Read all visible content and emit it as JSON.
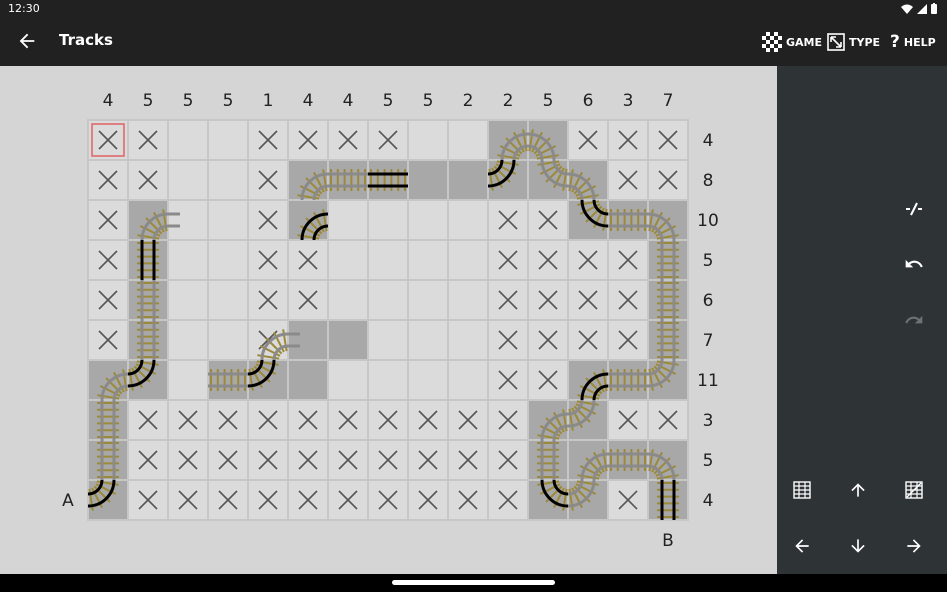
{
  "status": {
    "time": "12:30"
  },
  "appbar": {
    "title": "Tracks",
    "game_label": "GAME",
    "type_label": "TYPE",
    "help_label": "HELP"
  },
  "puzzle": {
    "col_clues": [
      "4",
      "5",
      "5",
      "5",
      "1",
      "4",
      "4",
      "5",
      "5",
      "2",
      "2",
      "5",
      "6",
      "3",
      "7"
    ],
    "row_clues": [
      "4",
      "8",
      "10",
      "5",
      "6",
      "7",
      "11",
      "3",
      "5",
      "4"
    ],
    "entry_label": "A",
    "exit_label": "B",
    "selected_cell": [
      0,
      0
    ],
    "filled_cells": [
      [
        0,
        10
      ],
      [
        0,
        11
      ],
      [
        1,
        5
      ],
      [
        1,
        6
      ],
      [
        1,
        7
      ],
      [
        1,
        8
      ],
      [
        1,
        9
      ],
      [
        1,
        10
      ],
      [
        1,
        11
      ],
      [
        1,
        12
      ],
      [
        2,
        1
      ],
      [
        2,
        5
      ],
      [
        2,
        12
      ],
      [
        2,
        13
      ],
      [
        2,
        14
      ],
      [
        3,
        1
      ],
      [
        3,
        14
      ],
      [
        4,
        1
      ],
      [
        4,
        14
      ],
      [
        5,
        1
      ],
      [
        5,
        5
      ],
      [
        5,
        6
      ],
      [
        5,
        14
      ],
      [
        6,
        0
      ],
      [
        6,
        1
      ],
      [
        6,
        3
      ],
      [
        6,
        4
      ],
      [
        6,
        5
      ],
      [
        6,
        12
      ],
      [
        6,
        13
      ],
      [
        6,
        14
      ],
      [
        7,
        0
      ],
      [
        7,
        11
      ],
      [
        7,
        12
      ],
      [
        8,
        0
      ],
      [
        8,
        11
      ],
      [
        8,
        12
      ],
      [
        8,
        13
      ],
      [
        8,
        14
      ],
      [
        9,
        0
      ],
      [
        9,
        11
      ],
      [
        9,
        12
      ],
      [
        9,
        14
      ]
    ],
    "crossed_cells": [
      [
        0,
        0
      ],
      [
        0,
        1
      ],
      [
        0,
        4
      ],
      [
        0,
        5
      ],
      [
        0,
        6
      ],
      [
        0,
        7
      ],
      [
        0,
        12
      ],
      [
        0,
        13
      ],
      [
        0,
        14
      ],
      [
        1,
        0
      ],
      [
        1,
        1
      ],
      [
        1,
        4
      ],
      [
        1,
        13
      ],
      [
        1,
        14
      ],
      [
        2,
        0
      ],
      [
        2,
        4
      ],
      [
        2,
        10
      ],
      [
        2,
        11
      ],
      [
        3,
        0
      ],
      [
        3,
        4
      ],
      [
        3,
        5
      ],
      [
        3,
        10
      ],
      [
        3,
        11
      ],
      [
        3,
        12
      ],
      [
        3,
        13
      ],
      [
        4,
        0
      ],
      [
        4,
        4
      ],
      [
        4,
        5
      ],
      [
        4,
        10
      ],
      [
        4,
        11
      ],
      [
        4,
        12
      ],
      [
        4,
        13
      ],
      [
        5,
        0
      ],
      [
        5,
        4
      ],
      [
        5,
        10
      ],
      [
        5,
        11
      ],
      [
        5,
        12
      ],
      [
        5,
        13
      ],
      [
        6,
        10
      ],
      [
        6,
        11
      ],
      [
        7,
        1
      ],
      [
        7,
        2
      ],
      [
        7,
        3
      ],
      [
        7,
        4
      ],
      [
        7,
        5
      ],
      [
        7,
        6
      ],
      [
        7,
        7
      ],
      [
        7,
        8
      ],
      [
        7,
        9
      ],
      [
        7,
        10
      ],
      [
        7,
        13
      ],
      [
        7,
        14
      ],
      [
        8,
        1
      ],
      [
        8,
        2
      ],
      [
        8,
        3
      ],
      [
        8,
        4
      ],
      [
        8,
        5
      ],
      [
        8,
        6
      ],
      [
        8,
        7
      ],
      [
        8,
        8
      ],
      [
        8,
        9
      ],
      [
        8,
        10
      ],
      [
        9,
        1
      ],
      [
        9,
        2
      ],
      [
        9,
        3
      ],
      [
        9,
        4
      ],
      [
        9,
        5
      ],
      [
        9,
        6
      ],
      [
        9,
        7
      ],
      [
        9,
        8
      ],
      [
        9,
        9
      ],
      [
        9,
        10
      ],
      [
        9,
        13
      ]
    ],
    "track_segments": [
      {
        "type": "curve",
        "cell": [
          9,
          0
        ],
        "from": "W",
        "to": "N",
        "fixed": true
      },
      {
        "type": "straight",
        "cell": [
          8,
          0
        ],
        "dir": "V"
      },
      {
        "type": "straight",
        "cell": [
          7,
          0
        ],
        "dir": "V"
      },
      {
        "type": "curve",
        "cell": [
          6,
          0
        ],
        "from": "S",
        "to": "E"
      },
      {
        "type": "curve",
        "cell": [
          6,
          1
        ],
        "from": "W",
        "to": "N",
        "fixed": true
      },
      {
        "type": "straight",
        "cell": [
          5,
          1
        ],
        "dir": "V"
      },
      {
        "type": "straight",
        "cell": [
          4,
          1
        ],
        "dir": "V"
      },
      {
        "type": "straight",
        "cell": [
          3,
          1
        ],
        "dir": "V",
        "fixed": true
      },
      {
        "type": "curve",
        "cell": [
          2,
          1
        ],
        "from": "S",
        "to": "E"
      },
      {
        "type": "stub",
        "cell": [
          2,
          2
        ],
        "dir": "W"
      },
      {
        "type": "straight",
        "cell": [
          6,
          3
        ],
        "dir": "H"
      },
      {
        "type": "curve",
        "cell": [
          6,
          4
        ],
        "from": "W",
        "to": "N",
        "fixed": true
      },
      {
        "type": "curve",
        "cell": [
          5,
          4
        ],
        "from": "S",
        "to": "E"
      },
      {
        "type": "stub",
        "cell": [
          5,
          5
        ],
        "dir": "W"
      },
      {
        "type": "curve",
        "cell": [
          2,
          5
        ],
        "from": "S",
        "to": "E",
        "fixed": true
      },
      {
        "type": "curve",
        "cell": [
          1,
          5
        ],
        "from": "S",
        "to": "E"
      },
      {
        "type": "straight",
        "cell": [
          1,
          6
        ],
        "dir": "H"
      },
      {
        "type": "straight",
        "cell": [
          1,
          7
        ],
        "dir": "H",
        "fixed": true
      },
      {
        "type": "curve",
        "cell": [
          1,
          10
        ],
        "from": "W",
        "to": "N",
        "fixed": true
      },
      {
        "type": "curve",
        "cell": [
          0,
          10
        ],
        "from": "S",
        "to": "E"
      },
      {
        "type": "curve",
        "cell": [
          0,
          11
        ],
        "from": "W",
        "to": "S"
      },
      {
        "type": "curve",
        "cell": [
          1,
          11
        ],
        "from": "N",
        "to": "E"
      },
      {
        "type": "curve",
        "cell": [
          1,
          12
        ],
        "from": "W",
        "to": "S"
      },
      {
        "type": "curve",
        "cell": [
          2,
          12
        ],
        "from": "N",
        "to": "E",
        "fixed": true
      },
      {
        "type": "straight",
        "cell": [
          2,
          13
        ],
        "dir": "H"
      },
      {
        "type": "curve",
        "cell": [
          2,
          14
        ],
        "from": "W",
        "to": "S"
      },
      {
        "type": "straight",
        "cell": [
          3,
          14
        ],
        "dir": "V"
      },
      {
        "type": "straight",
        "cell": [
          4,
          14
        ],
        "dir": "V"
      },
      {
        "type": "straight",
        "cell": [
          5,
          14
        ],
        "dir": "V"
      },
      {
        "type": "curve",
        "cell": [
          6,
          14
        ],
        "from": "N",
        "to": "W"
      },
      {
        "type": "straight",
        "cell": [
          6,
          13
        ],
        "dir": "H"
      },
      {
        "type": "curve",
        "cell": [
          6,
          12
        ],
        "from": "E",
        "to": "S",
        "fixed": true
      },
      {
        "type": "curve",
        "cell": [
          7,
          12
        ],
        "from": "N",
        "to": "W"
      },
      {
        "type": "curve",
        "cell": [
          7,
          11
        ],
        "from": "E",
        "to": "S"
      },
      {
        "type": "straight",
        "cell": [
          8,
          11
        ],
        "dir": "V"
      },
      {
        "type": "curve",
        "cell": [
          9,
          11
        ],
        "from": "N",
        "to": "E",
        "fixed": true
      },
      {
        "type": "curve",
        "cell": [
          9,
          12
        ],
        "from": "W",
        "to": "N"
      },
      {
        "type": "curve",
        "cell": [
          8,
          12
        ],
        "from": "S",
        "to": "E"
      },
      {
        "type": "straight",
        "cell": [
          8,
          13
        ],
        "dir": "H"
      },
      {
        "type": "curve",
        "cell": [
          8,
          14
        ],
        "from": "W",
        "to": "S"
      },
      {
        "type": "straight",
        "cell": [
          9,
          14
        ],
        "dir": "V",
        "fixed": true
      }
    ]
  },
  "colors": {
    "grid_bg": "#d6d5d6",
    "cell_empty": "#dcdbdc",
    "cell_filled": "#a9a8a9",
    "cross": "#555555",
    "sleeper": "#9c8a38",
    "rail": "#8a8a8a",
    "fixed_rail": "#000000",
    "selected": "#e06060",
    "sidebar_bg": "#2e3335"
  }
}
